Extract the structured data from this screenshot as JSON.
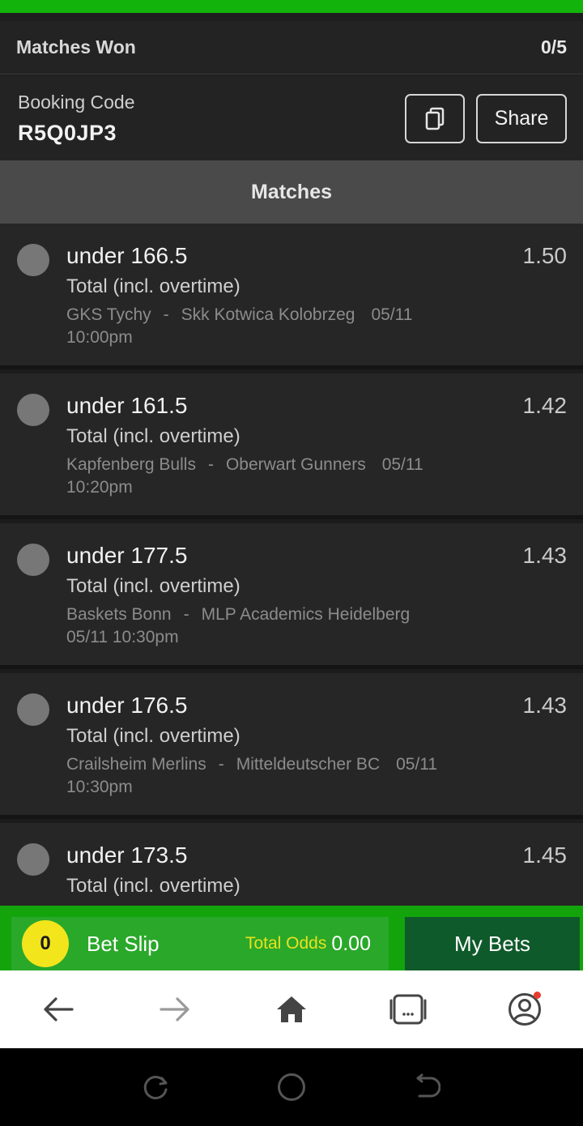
{
  "summary": {
    "matches_won_label": "Matches Won",
    "matches_won_value": "0/5"
  },
  "booking": {
    "label": "Booking Code",
    "code": "R5Q0JP3",
    "share_label": "Share"
  },
  "matches_header": "Matches",
  "matches": [
    {
      "pick": "under 166.5",
      "odds": "1.50",
      "market": "Total (incl. overtime)",
      "home": "GKS Tychy",
      "sep": "-",
      "away": "Skk Kotwica Kolobrzeg",
      "date": "05/11",
      "time": "10:00pm"
    },
    {
      "pick": "under 161.5",
      "odds": "1.42",
      "market": "Total (incl. overtime)",
      "home": "Kapfenberg Bulls",
      "sep": "-",
      "away": "Oberwart Gunners",
      "date": "05/11",
      "time": "10:20pm"
    },
    {
      "pick": "under 177.5",
      "odds": "1.43",
      "market": "Total (incl. overtime)",
      "home": "Baskets Bonn",
      "sep": "-",
      "away": "MLP Academics Heidelberg",
      "date": "05/11",
      "time": "10:30pm"
    },
    {
      "pick": "under 176.5",
      "odds": "1.43",
      "market": "Total (incl. overtime)",
      "home": "Crailsheim Merlins",
      "sep": "-",
      "away": "Mitteldeutscher BC",
      "date": "05/11",
      "time": "10:30pm"
    },
    {
      "pick": "under 173.5",
      "odds": "1.45",
      "market": "Total (incl. overtime)"
    }
  ],
  "betslip": {
    "count": "0",
    "label": "Bet Slip",
    "total_odds_label": "Total Odds",
    "total_odds_value": "0.00",
    "my_bets_label": "My Bets"
  },
  "colors": {
    "brand_green": "#12b30a",
    "badge_yellow": "#f3e51c",
    "my_bets_bg": "#0f5a2a"
  },
  "icons": [
    "copy-icon",
    "back-arrow-icon",
    "forward-arrow-icon",
    "home-icon",
    "tabs-icon",
    "account-icon",
    "recents-icon",
    "home-circle-icon",
    "system-back-icon"
  ]
}
